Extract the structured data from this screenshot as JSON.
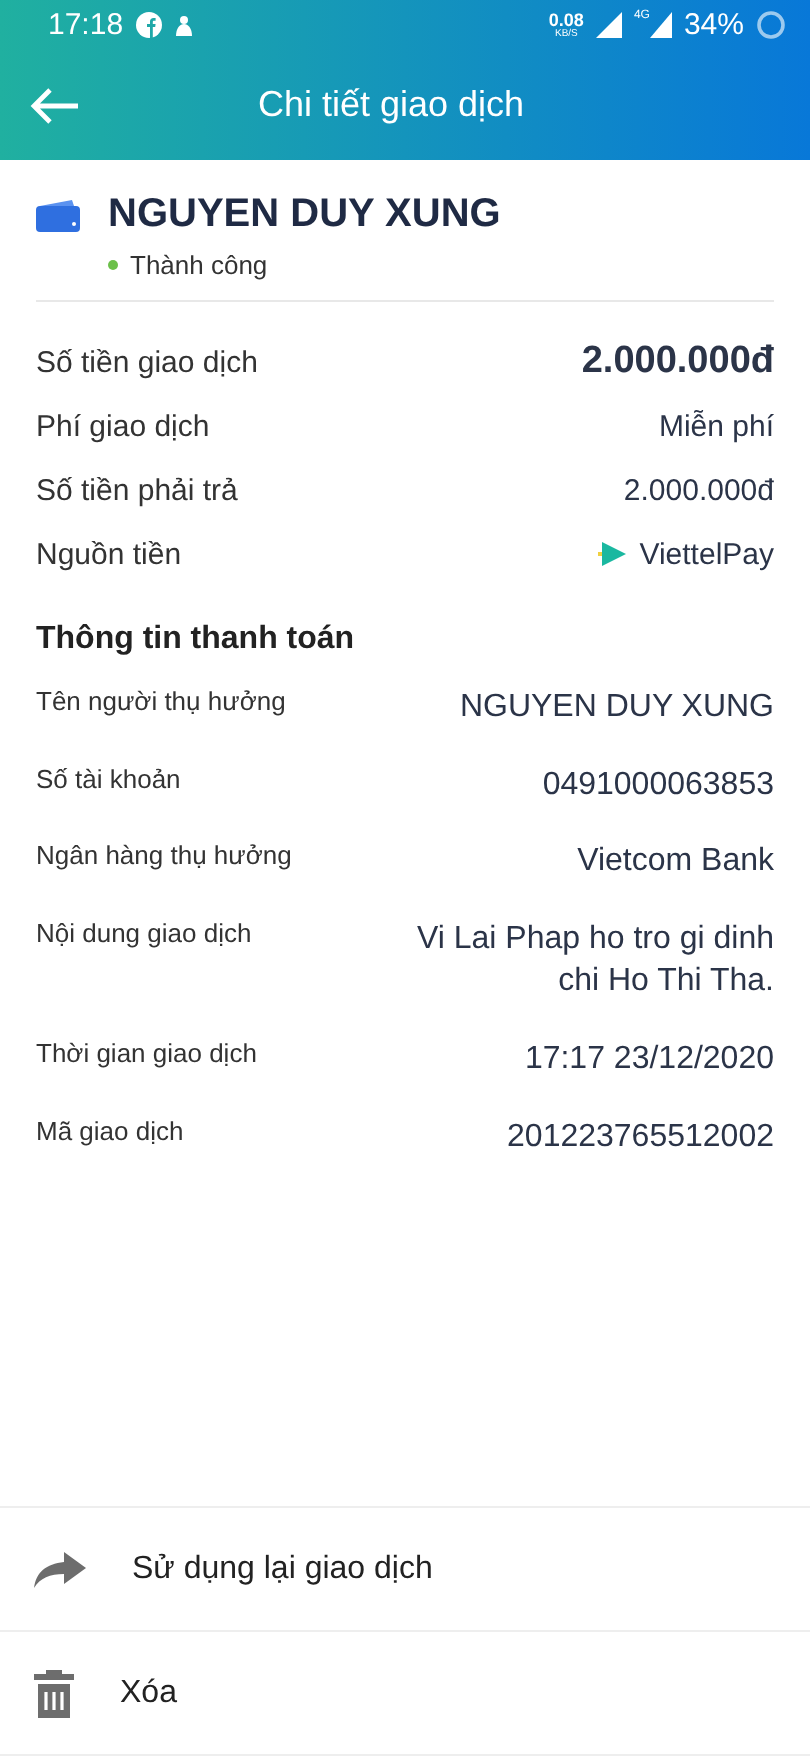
{
  "status_bar": {
    "time": "17:18",
    "speed": "0.08",
    "speed_unit": "KB/S",
    "network": "4G",
    "battery": "34%"
  },
  "header": {
    "title": "Chi tiết giao dịch"
  },
  "recipient": {
    "name": "NGUYEN DUY XUNG",
    "status": "Thành công"
  },
  "summary": [
    {
      "label": "Số tiền giao dịch",
      "value": "2.000.000đ",
      "kind": "total"
    },
    {
      "label": "Phí giao dịch",
      "value": "Miễn phí",
      "kind": "text"
    },
    {
      "label": "Số tiền phải trả",
      "value": "2.000.000đ",
      "kind": "text"
    },
    {
      "label": "Nguồn tiền",
      "value": "ViettelPay",
      "kind": "wallet"
    }
  ],
  "payment_info": {
    "title": "Thông tin thanh toán",
    "rows": [
      {
        "label": "Tên người thụ hưởng",
        "value": "NGUYEN DUY XUNG"
      },
      {
        "label": "Số tài khoản",
        "value": "0491000063853"
      },
      {
        "label": "Ngân hàng thụ hưởng",
        "value": "Vietcom Bank"
      },
      {
        "label": "Nội dung giao dịch",
        "value": "Vi Lai Phap ho tro gi dinh chi Ho Thi Tha."
      },
      {
        "label": "Thời gian giao dịch",
        "value": "17:17 23/12/2020"
      },
      {
        "label": "Mã giao dịch",
        "value": "201223765512002"
      }
    ]
  },
  "actions": [
    {
      "label": "Sử dụng lại giao dịch",
      "kind": "reuse"
    },
    {
      "label": "Xóa",
      "kind": "delete"
    }
  ]
}
